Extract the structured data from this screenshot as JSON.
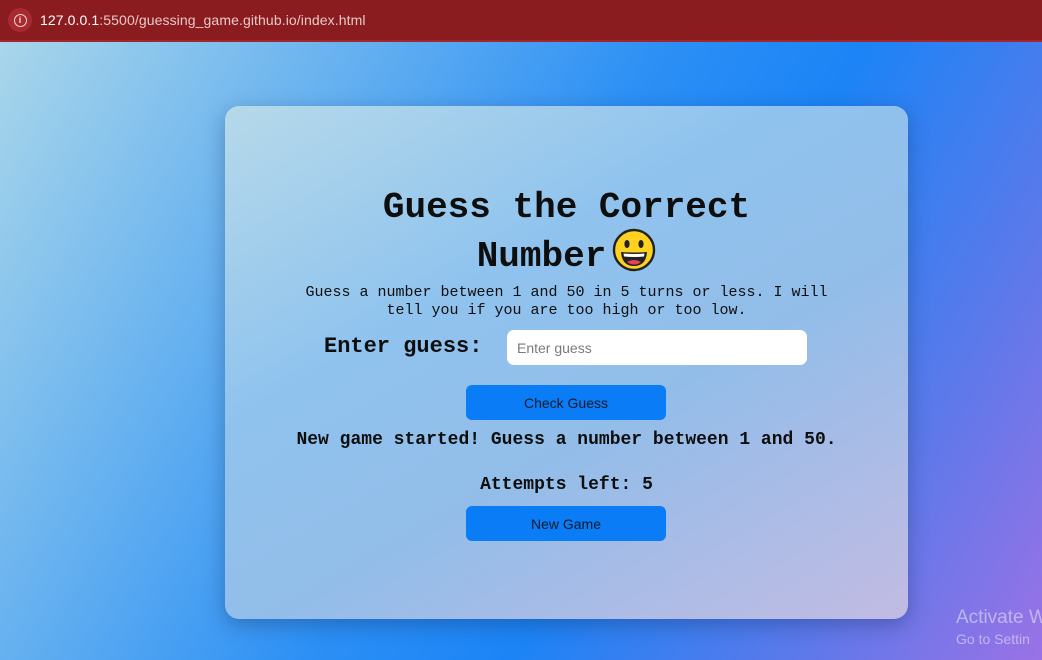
{
  "browser": {
    "url_host": "127.0.0.1",
    "url_rest": ":5500/guessing_game.github.io/index.html"
  },
  "game": {
    "title": "Guess the Correct Number",
    "title_emoji": "grinning-face",
    "instructions": "Guess a number between 1 and 50 in 5 turns or less. I will tell you if you are too high or too low.",
    "guess_label": "Enter guess:",
    "guess_placeholder": "Enter guess",
    "guess_value": "",
    "check_button": "Check Guess",
    "message": "New game started! Guess a number between 1 and 50.",
    "attempts": "Attempts left: 5",
    "new_game_button": "New Game"
  },
  "watermark": {
    "line1": "Activate W",
    "line2": "Go to Settin"
  },
  "colors": {
    "address_bar": "#8a1c1f",
    "button": "#0a7cf5"
  }
}
